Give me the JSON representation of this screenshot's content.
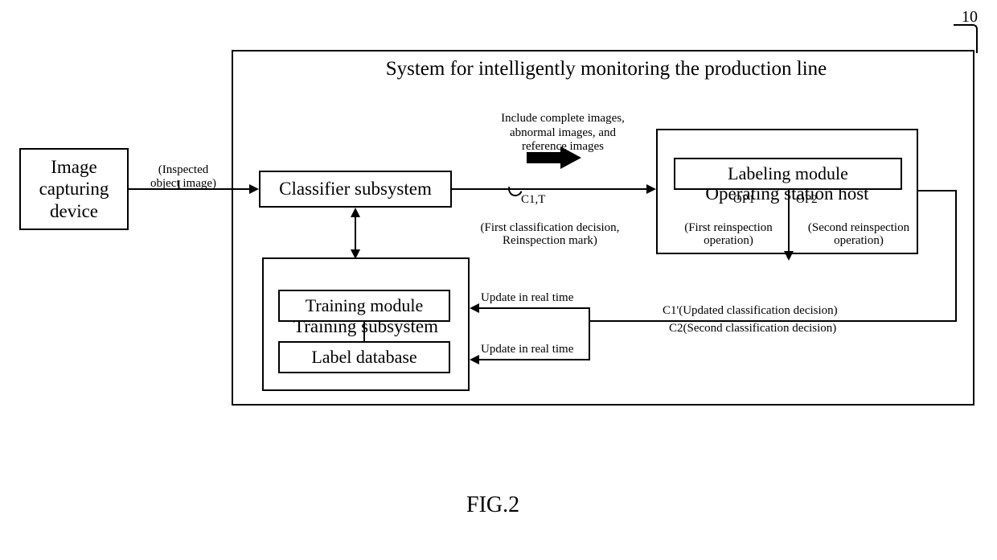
{
  "blocks": {
    "image_capturing": "Image\ncapturing\ndevice",
    "classifier": "Classifier subsystem",
    "training_subsystem": "Training subsystem",
    "training_module": "Training module",
    "label_database": "Label database",
    "operating_host": "Operating station host",
    "labeling_module": "Labeling module"
  },
  "system_title": "System for intelligently monitoring the production line",
  "labels": {
    "inspected": "(Inspected\nobject image)",
    "inspected_i": "I",
    "include_images": "Include complete images,\nabnormal images, and\nreference images",
    "c1t": "C1,T",
    "c1t_desc": "(First classification decision,\nReinspection mark)",
    "op1": "OP1",
    "op1_desc": "(First reinspection\noperation)",
    "op2": "OP2",
    "op2_desc": "(Second reinspection\noperation)",
    "update1": "Update in real time",
    "update2": "Update in real time",
    "c1_prime": "C1'(Updated classification decision)",
    "c2": "C2(Second classification decision)",
    "ref_10": "10"
  },
  "figure_label": "FIG.2"
}
